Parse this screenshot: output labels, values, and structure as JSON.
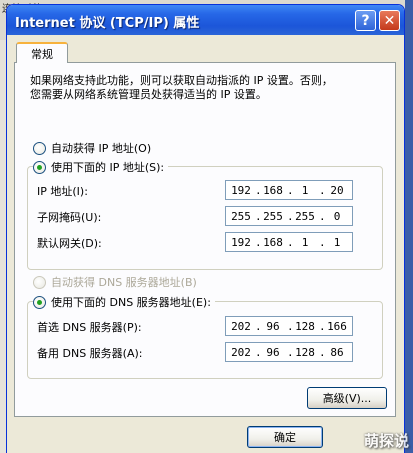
{
  "backdrop": {
    "text": "连接时使用"
  },
  "dialog": {
    "title": "Internet 协议 (TCP/IP) 属性",
    "help_glyph": "?",
    "close_glyph": "✕",
    "tab_label": "常规",
    "intro": "如果网络支持此功能，则可以获取自动指派的 IP 设置。否则，\n您需要从网络系统管理员处获得适当的 IP 设置。",
    "ip_section": {
      "auto_label": "自动获得 IP 地址(O)",
      "manual_label": "使用下面的 IP 地址(S):",
      "selected": "manual",
      "fields": [
        {
          "label": "IP 地址(I):",
          "octets": [
            "192",
            "168",
            "1",
            "20"
          ]
        },
        {
          "label": "子网掩码(U):",
          "octets": [
            "255",
            "255",
            "255",
            "0"
          ]
        },
        {
          "label": "默认网关(D):",
          "octets": [
            "192",
            "168",
            "1",
            "1"
          ]
        }
      ]
    },
    "dns_section": {
      "auto_label": "自动获得 DNS 服务器地址(B)",
      "auto_disabled": true,
      "manual_label": "使用下面的 DNS 服务器地址(E):",
      "selected": "manual",
      "fields": [
        {
          "label": "首选 DNS 服务器(P):",
          "octets": [
            "202",
            "96",
            "128",
            "166"
          ]
        },
        {
          "label": "备用 DNS 服务器(A):",
          "octets": [
            "202",
            "96",
            "128",
            "86"
          ]
        }
      ]
    },
    "advanced_button": "高级(V)...",
    "ok_button": "确定"
  },
  "watermark": "萌探说",
  "colors": {
    "titlebar": "#1c56d9",
    "dialog_bg": "#ece9d8",
    "panel_bg": "#fcfcfe",
    "radio_dot": "#21a121",
    "tab_accent": "#f7b23c"
  }
}
